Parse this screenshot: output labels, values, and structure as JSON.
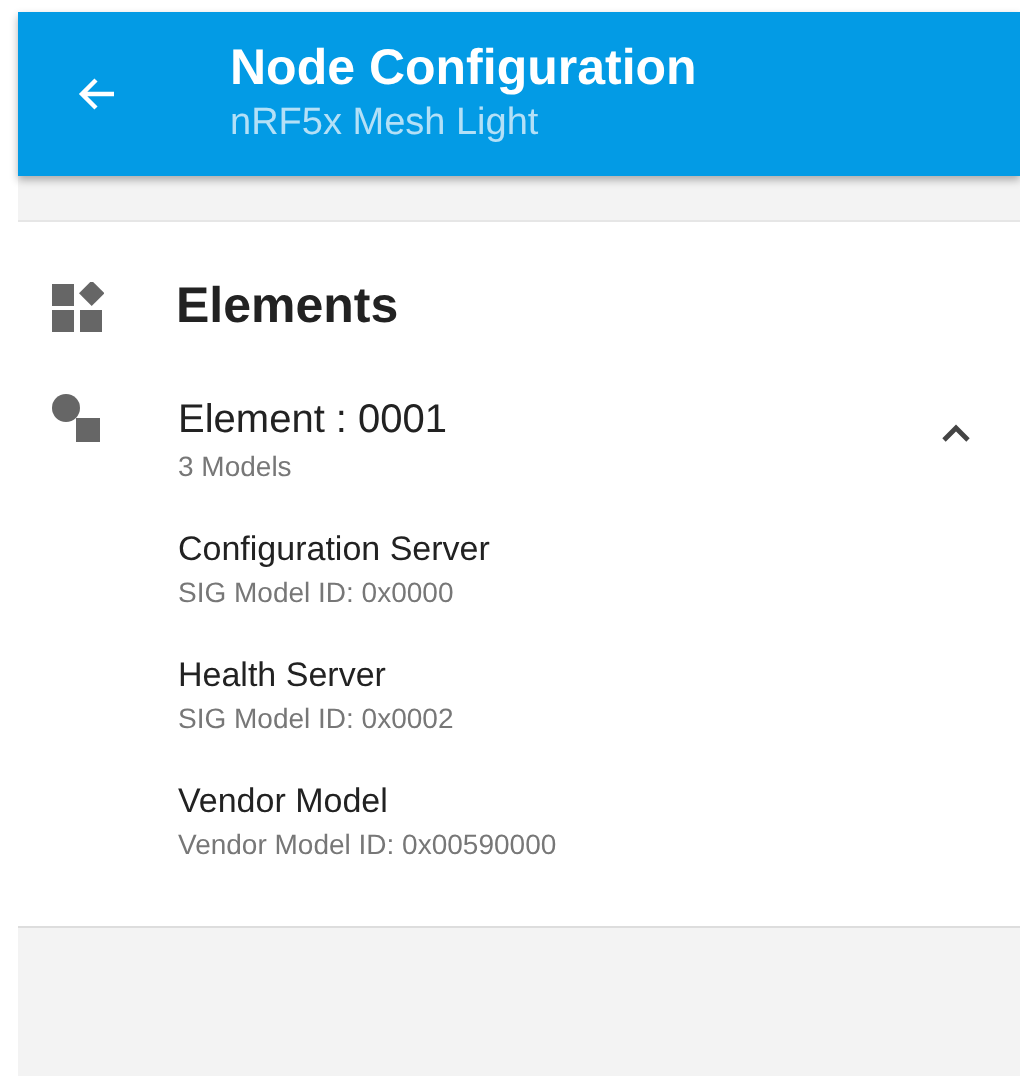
{
  "app_bar": {
    "title": "Node Configuration",
    "subtitle": "nRF5x Mesh Light"
  },
  "elements_section": {
    "title": "Elements",
    "elements": [
      {
        "name": "Element : 0001",
        "summary": "3 Models",
        "expanded": true,
        "models": [
          {
            "name": "Configuration Server",
            "id": "SIG Model ID: 0x0000"
          },
          {
            "name": "Health Server",
            "id": "SIG Model ID: 0x0002"
          },
          {
            "name": "Vendor Model",
            "id": "Vendor Model ID: 0x00590000"
          }
        ]
      }
    ]
  }
}
